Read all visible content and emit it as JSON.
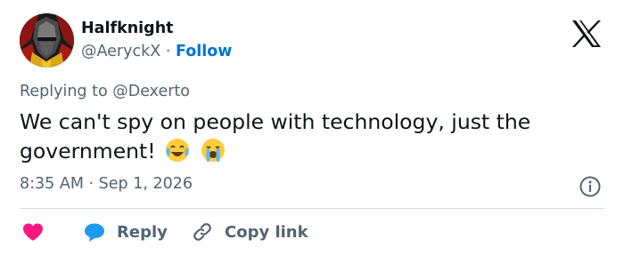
{
  "author": {
    "name": "Halfknight",
    "handle": "@AeryckX",
    "separator": "·",
    "follow_label": "Follow",
    "avatar_icon": "knight-helmet-avatar"
  },
  "platform_icon": "x-logo",
  "reply_context": "Replying to @Dexerto",
  "tweet": {
    "text": "We can't spy on people with technology, just the government!",
    "emojis": [
      "face-with-tears-of-joy",
      "loudly-crying-face"
    ]
  },
  "timestamp": {
    "time": "8:35 AM",
    "separator": "·",
    "date": "Sep 1, 2026"
  },
  "actions": {
    "like_icon": "heart-icon",
    "reply_label": "Reply",
    "reply_icon": "speech-bubble-icon",
    "copy_label": "Copy link",
    "copy_icon": "link-icon"
  },
  "colors": {
    "accent": "#0074d4",
    "like": "#f91880",
    "reply": "#1d9bf0",
    "secondary_text": "#536471"
  }
}
